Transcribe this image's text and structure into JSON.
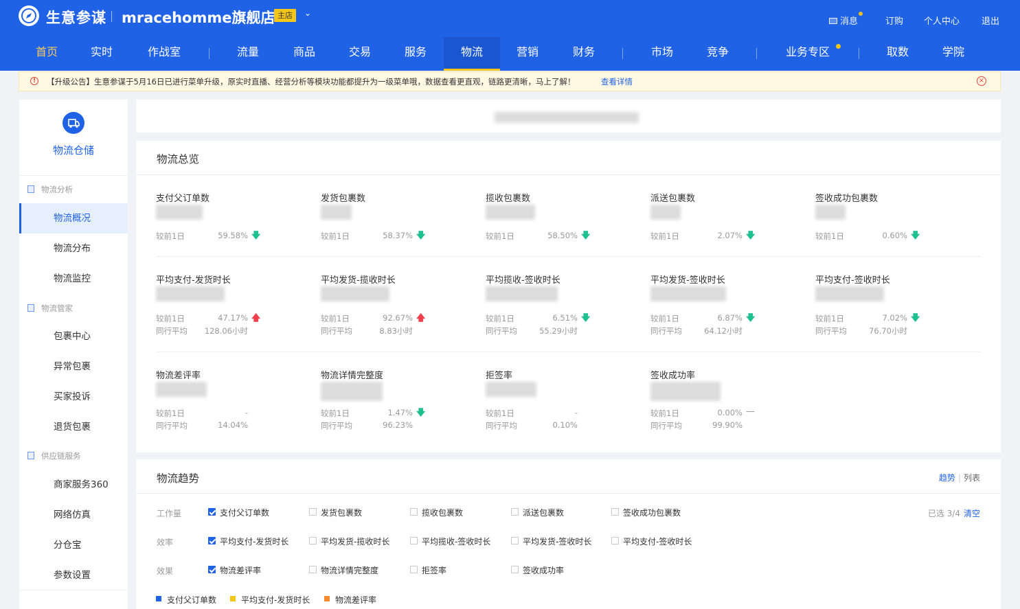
{
  "header": {
    "brand": "生意参谋",
    "shop_name": "mracehomme旗舰店",
    "shop_tag": "主店",
    "right_links": {
      "messages": "消息",
      "subscribe": "订购",
      "personal": "个人中心",
      "logout": "退出"
    }
  },
  "nav": {
    "items": [
      "首页",
      "实时",
      "作战室",
      "流量",
      "商品",
      "交易",
      "服务",
      "物流",
      "营销",
      "财务",
      "市场",
      "竞争",
      "业务专区",
      "取数",
      "学院"
    ],
    "active": "物流"
  },
  "notice": {
    "text": "【升级公告】生意参谋于5月16日已进行菜单升级，原实时直播、经营分析等模块功能都提升为一级菜单哦，数据查看更直观，链路更清晰，马上了解！",
    "link": "查看详情"
  },
  "sidebar": {
    "title": "物流仓储",
    "groups": [
      {
        "label": "物流分析",
        "items": [
          "物流概况",
          "物流分布",
          "物流监控"
        ]
      },
      {
        "label": "物流管家",
        "items": [
          "包裹中心",
          "异常包裹",
          "买家投诉",
          "退货包裹"
        ]
      },
      {
        "label": "供应链服务",
        "items": [
          "商家服务360",
          "网络仿真",
          "分仓宝",
          "参数设置"
        ]
      }
    ],
    "active_item": "物流概况"
  },
  "overview": {
    "title": "物流总览",
    "row1": [
      {
        "name": "支付父订单数",
        "cmp_label": "较前1日",
        "cmp_value": "59.58%",
        "trend": "down"
      },
      {
        "name": "发货包裹数",
        "cmp_label": "较前1日",
        "cmp_value": "58.37%",
        "trend": "down"
      },
      {
        "name": "揽收包裹数",
        "cmp_label": "较前1日",
        "cmp_value": "58.50%",
        "trend": "down"
      },
      {
        "name": "派送包裹数",
        "cmp_label": "较前1日",
        "cmp_value": "2.07%",
        "trend": "down"
      },
      {
        "name": "签收成功包裹数",
        "cmp_label": "较前1日",
        "cmp_value": "0.60%",
        "trend": "down"
      }
    ],
    "row2": [
      {
        "name": "平均支付-发货时长",
        "cmp_label": "较前1日",
        "cmp_value": "47.17%",
        "trend": "up",
        "peer_label": "同行平均",
        "peer_value": "128.06小时"
      },
      {
        "name": "平均发货-揽收时长",
        "cmp_label": "较前1日",
        "cmp_value": "92.67%",
        "trend": "up",
        "peer_label": "同行平均",
        "peer_value": "8.83小时"
      },
      {
        "name": "平均揽收-签收时长",
        "cmp_label": "较前1日",
        "cmp_value": "6.51%",
        "trend": "down",
        "peer_label": "同行平均",
        "peer_value": "55.29小时"
      },
      {
        "name": "平均发货-签收时长",
        "cmp_label": "较前1日",
        "cmp_value": "6.87%",
        "trend": "down",
        "peer_label": "同行平均",
        "peer_value": "64.12小时"
      },
      {
        "name": "平均支付-签收时长",
        "cmp_label": "较前1日",
        "cmp_value": "7.02%",
        "trend": "down",
        "peer_label": "同行平均",
        "peer_value": "76.70小时"
      }
    ],
    "row3": [
      {
        "name": "物流差评率",
        "cmp_label": "较前1日",
        "cmp_value": "-",
        "trend": "none",
        "peer_label": "同行平均",
        "peer_value": "14.04%"
      },
      {
        "name": "物流详情完整度",
        "cmp_label": "较前1日",
        "cmp_value": "1.47%",
        "trend": "down",
        "peer_label": "同行平均",
        "peer_value": "96.23%"
      },
      {
        "name": "拒签率",
        "cmp_label": "较前1日",
        "cmp_value": "-",
        "trend": "none",
        "peer_label": "同行平均",
        "peer_value": "0.10%"
      },
      {
        "name": "签收成功率",
        "cmp_label": "较前1日",
        "cmp_value": "0.00%",
        "trend": "flat",
        "peer_label": "同行平均",
        "peer_value": "99.90%"
      }
    ]
  },
  "trend": {
    "title": "物流趋势",
    "tab_trend": "趋势",
    "tab_list": "列表",
    "selected_text": "已选 3/4",
    "clear": "清空",
    "filters": [
      {
        "label": "工作量",
        "options": [
          {
            "text": "支付父订单数",
            "checked": true
          },
          {
            "text": "发货包裹数",
            "checked": false
          },
          {
            "text": "揽收包裹数",
            "checked": false
          },
          {
            "text": "派送包裹数",
            "checked": false
          },
          {
            "text": "签收成功包裹数",
            "checked": false
          }
        ]
      },
      {
        "label": "效率",
        "options": [
          {
            "text": "平均支付-发货时长",
            "checked": true
          },
          {
            "text": "平均发货-揽收时长",
            "checked": false
          },
          {
            "text": "平均揽收-签收时长",
            "checked": false
          },
          {
            "text": "平均发货-签收时长",
            "checked": false
          },
          {
            "text": "平均支付-签收时长",
            "checked": false
          }
        ]
      },
      {
        "label": "效果",
        "options": [
          {
            "text": "物流差评率",
            "checked": true
          },
          {
            "text": "物流详情完整度",
            "checked": false
          },
          {
            "text": "拒签率",
            "checked": false
          },
          {
            "text": "签收成功率",
            "checked": false
          }
        ]
      }
    ],
    "legend": [
      {
        "text": "支付父订单数",
        "color": "#2062e6"
      },
      {
        "text": "平均支付-发货时长",
        "color": "#f5c518"
      },
      {
        "text": "物流差评率",
        "color": "#f58a2c"
      }
    ]
  }
}
